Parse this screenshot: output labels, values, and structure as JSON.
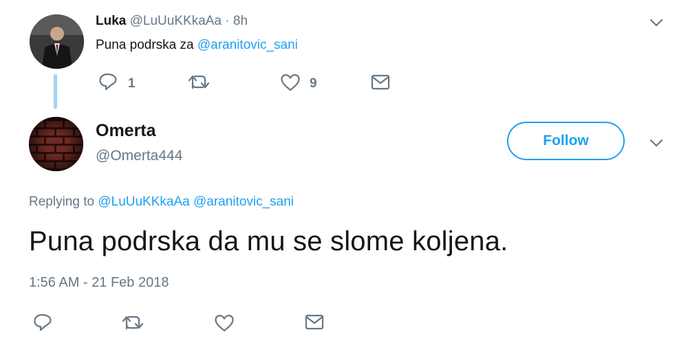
{
  "parent_tweet": {
    "name": "Luka",
    "handle": "@LuUuKKkaAa",
    "separator": " · ",
    "time": "8h",
    "text_prefix": "Puna podrska za ",
    "text_mention": "@aranitovic_sani",
    "reply_count": "1",
    "like_count": "9"
  },
  "main_tweet": {
    "name": "Omerta",
    "handle": "@Omerta444",
    "follow_label": "Follow",
    "replying_prefix": "Replying to ",
    "replying_mention_1": "@LuUuKKkaAa",
    "replying_mention_2": "@aranitovic_sani",
    "text": "Puna podrska da mu se slome koljena.",
    "timestamp": "1:56 AM - 21 Feb 2018"
  },
  "colors": {
    "accent": "#1da1f2",
    "thread_line": "#a5d2f3",
    "muted": "#657786"
  }
}
